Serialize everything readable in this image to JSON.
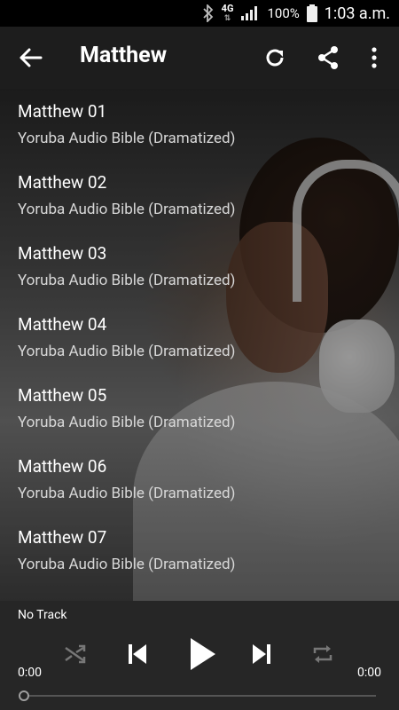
{
  "status_bar": {
    "network": "4G",
    "battery": "100%",
    "time": "1:03 a.m."
  },
  "app_bar": {
    "title": "Matthew"
  },
  "tracks": [
    {
      "title": "Matthew 01",
      "subtitle": "Yoruba Audio Bible (Dramatized)"
    },
    {
      "title": "Matthew 02",
      "subtitle": "Yoruba Audio Bible (Dramatized)"
    },
    {
      "title": "Matthew 03",
      "subtitle": "Yoruba Audio Bible (Dramatized)"
    },
    {
      "title": "Matthew 04",
      "subtitle": "Yoruba Audio Bible (Dramatized)"
    },
    {
      "title": "Matthew 05",
      "subtitle": "Yoruba Audio Bible (Dramatized)"
    },
    {
      "title": "Matthew 06",
      "subtitle": "Yoruba Audio Bible (Dramatized)"
    },
    {
      "title": "Matthew 07",
      "subtitle": "Yoruba Audio Bible (Dramatized)"
    }
  ],
  "player": {
    "now_playing": "No Track",
    "elapsed": "0:00",
    "duration": "0:00",
    "progress": 0
  }
}
